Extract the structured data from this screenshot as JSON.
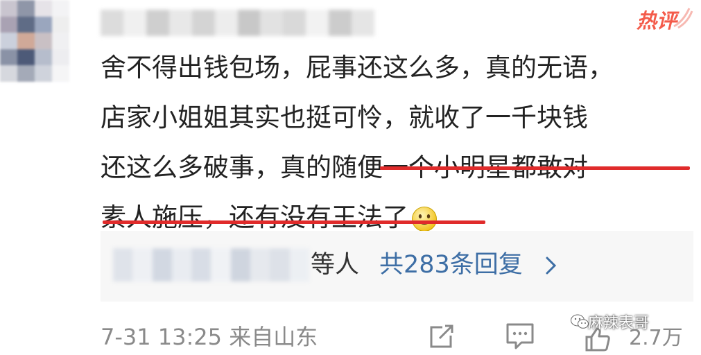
{
  "comment": {
    "badge": "热评",
    "lines": [
      "舍不得出钱包场，屁事还这么多，真的无语，",
      "店家小姐姐其实也挺可怜，就收了一千块钱",
      "还这么多破事，真的随便一个小明星都敢对",
      "素人施压，还有没有王法了"
    ],
    "underlined_segments": [
      "随便一个小明星都敢对",
      "素人施压，还有没有王法了"
    ],
    "emoji": "smile-emoji"
  },
  "replies": {
    "suffix": "等人",
    "count_label": "共283条回复"
  },
  "footer": {
    "time_source": "7-31 13:25 来自山东",
    "likes": "2.7万"
  },
  "watermark": {
    "text": "麻辣表哥"
  },
  "colors": {
    "badge": "#f45b4a",
    "underline": "#e02b2b",
    "link": "#3d6ea5",
    "meta": "#8a8a8a",
    "reply_bg": "#f7f7f7"
  }
}
